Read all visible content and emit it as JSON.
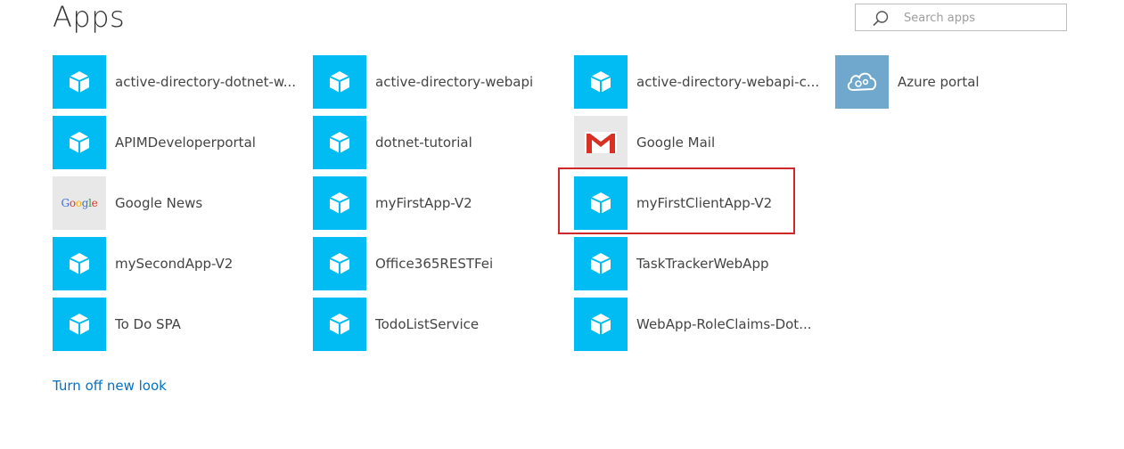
{
  "header": {
    "title": "Apps",
    "search_placeholder": "Search apps"
  },
  "apps": [
    {
      "label": "active-directory-dotnet-w...",
      "icon": "cube-icon"
    },
    {
      "label": "APIMDeveloperportal",
      "icon": "cube-icon"
    },
    {
      "label": "Google News",
      "icon": "google-logo-icon",
      "logo_text": "Google"
    },
    {
      "label": "mySecondApp-V2",
      "icon": "cube-icon"
    },
    {
      "label": "To Do SPA",
      "icon": "cube-icon"
    },
    {
      "label": "active-directory-webapi",
      "icon": "cube-icon"
    },
    {
      "label": "dotnet-tutorial",
      "icon": "cube-icon"
    },
    {
      "label": "myFirstApp-V2",
      "icon": "cube-icon"
    },
    {
      "label": "Office365RESTFei",
      "icon": "cube-icon"
    },
    {
      "label": "TodoListService",
      "icon": "cube-icon"
    },
    {
      "label": "active-directory-webapi-c...",
      "icon": "cube-icon"
    },
    {
      "label": "Google Mail",
      "icon": "gmail-icon"
    },
    {
      "label": "myFirstClientApp-V2",
      "icon": "cube-icon",
      "highlighted": true
    },
    {
      "label": "TaskTrackerWebApp",
      "icon": "cube-icon"
    },
    {
      "label": "WebApp-RoleClaims-Dot...",
      "icon": "cube-icon"
    },
    {
      "label": "Azure portal",
      "icon": "cloud-gear-icon"
    }
  ],
  "footer": {
    "turn_off_link": "Turn off new look"
  },
  "colors": {
    "tile_blue": "#00bcf2",
    "azure_tile": "#6fa8cc",
    "highlight_border": "#d0272d",
    "link": "#0072c6"
  }
}
